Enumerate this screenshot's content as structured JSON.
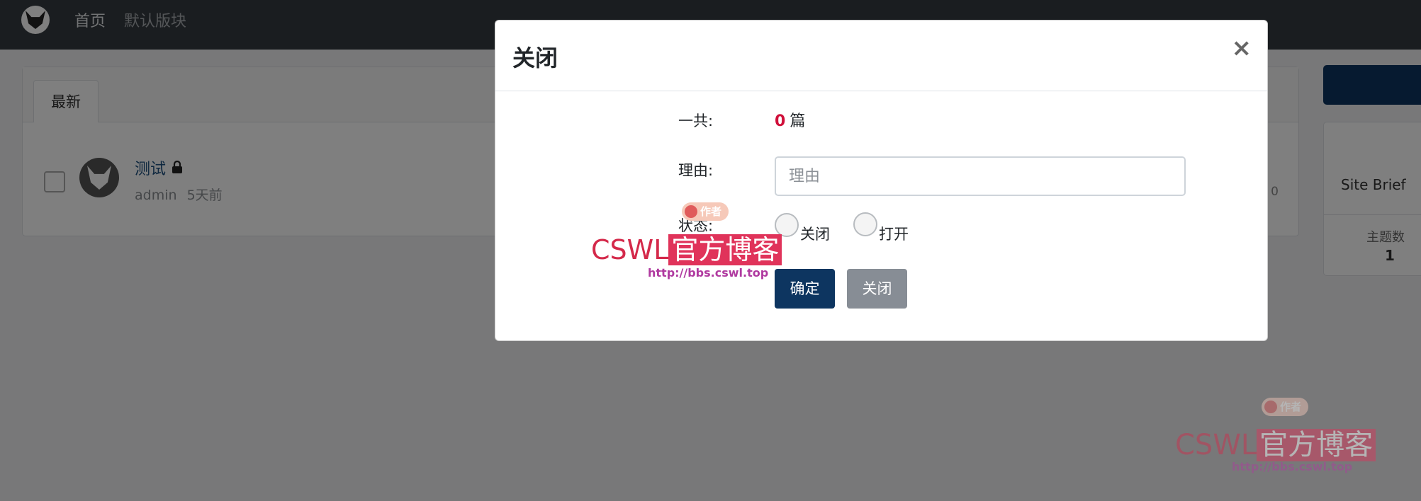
{
  "navbar": {
    "home_label": "首页",
    "section_label": "默认版块",
    "icon": "site-logo"
  },
  "background": {
    "tab_latest": "最新",
    "thread": {
      "title": "测试",
      "author": "admin",
      "time": "5天前",
      "count": "0"
    },
    "sidebar": {
      "site_brief": "Site Brief",
      "topics_label": "主题数",
      "topics_count": "1"
    }
  },
  "modal": {
    "title": "关闭",
    "close_symbol": "×",
    "total_label": "一共:",
    "total_count": "0",
    "total_unit": "篇",
    "reason_label": "理由:",
    "reason_placeholder": "理由",
    "reason_value": "",
    "status_label": "状态:",
    "status_options": [
      "关闭",
      "打开"
    ],
    "confirm_button": "确定",
    "close_button": "关闭"
  },
  "watermark": {
    "badge": "作者",
    "brand": "CSWL",
    "brand_cn": "官方博客",
    "url": "http://bbs.cswl.top"
  },
  "colors": {
    "navbar": "#343a40",
    "primary": "#0d3560",
    "secondary": "#878d95",
    "count_red": "#d0103a"
  }
}
